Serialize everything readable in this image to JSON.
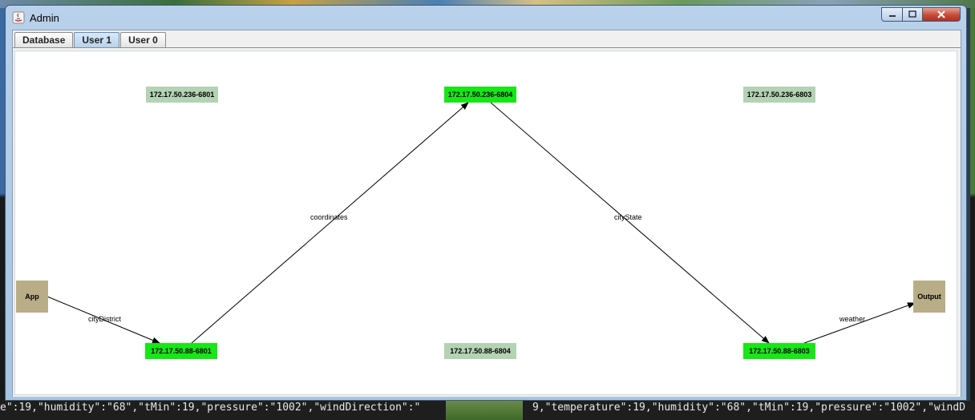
{
  "window": {
    "title": "Admin"
  },
  "tabs": [
    {
      "label": "Database",
      "selected": false
    },
    {
      "label": "User 1",
      "selected": true
    },
    {
      "label": "User 0",
      "selected": false
    }
  ],
  "graph": {
    "nodes": {
      "server_236_6801": {
        "label": "172.17.50.236-6801",
        "state": "idle"
      },
      "server_236_6804": {
        "label": "172.17.50.236-6804",
        "state": "active"
      },
      "server_236_6803": {
        "label": "172.17.50.236-6803",
        "state": "idle"
      },
      "app": {
        "label": "App",
        "state": "terminal"
      },
      "output": {
        "label": "Output",
        "state": "terminal"
      },
      "server_88_6801": {
        "label": "172.17.50.88-6801",
        "state": "active"
      },
      "server_88_6804": {
        "label": "172.17.50.88-6804",
        "state": "idle"
      },
      "server_88_6803": {
        "label": "172.17.50.88-6803",
        "state": "active"
      }
    },
    "edges": {
      "city_district": {
        "label": "cityDistrict",
        "from": "app",
        "to": "server_88_6801"
      },
      "coordinates": {
        "label": "coordinates",
        "from": "server_88_6801",
        "to": "server_236_6804"
      },
      "city_state": {
        "label": "cityState",
        "from": "server_236_6804",
        "to": "server_88_6803"
      },
      "weather": {
        "label": "weather",
        "from": "server_88_6803",
        "to": "output"
      }
    }
  },
  "colors": {
    "active_node": "#17e617",
    "idle_node": "#b4d2b4",
    "terminal_node": "#b9ad88"
  },
  "background_console": {
    "left_line": "e\":19,\"humidity\":\"68\",\"tMin\":19,\"pressure\":\"1002\",\"windDirection\":\"",
    "right_line": "9,\"temperature\":19,\"humidity\":\"68\",\"tMin\":19,\"pressure\":\"1002\",\"windD"
  }
}
